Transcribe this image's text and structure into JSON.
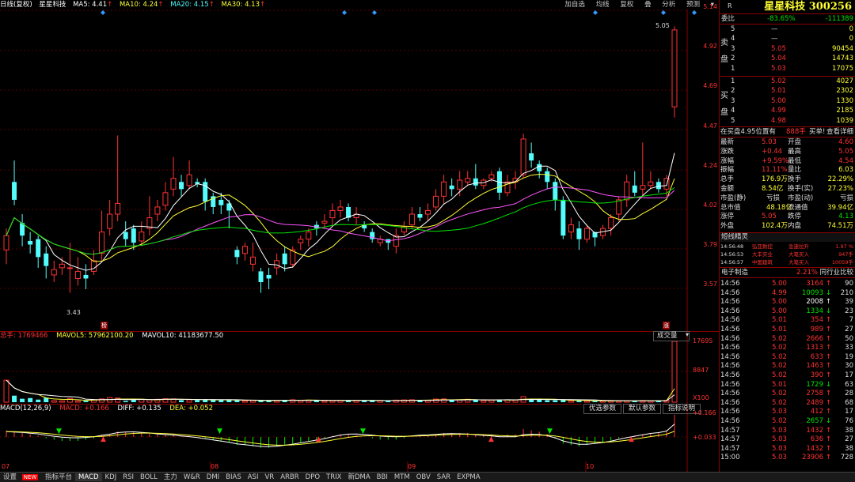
{
  "top": {
    "mode": "日线(复权)",
    "stock_name": "星星科技",
    "ma5": "MA5: 4.41",
    "ma10": "MA10: 4.24",
    "ma20": "MA20: 4.15",
    "ma30": "MA30: 4.13",
    "tools": [
      "加自选",
      "均线",
      "复权",
      "叠",
      "分析",
      "预测"
    ]
  },
  "price_axis": [
    "5.14",
    "4.92",
    "4.69",
    "4.47",
    "4.24",
    "4.02",
    "3.79",
    "3.57"
  ],
  "annotations": {
    "high": "5.05",
    "low": "3.43",
    "left_marker": "榜",
    "right_marker": "涨"
  },
  "volume": {
    "total": "总手: 1769466",
    "mavol5": "MAVOL5: 57962100.20",
    "mavol10": "MAVOL10: 41183677.50",
    "dropdown": "成交量",
    "axis": [
      "17695",
      "8847",
      "X100"
    ]
  },
  "macd": {
    "params": "MACD(12,26,9)",
    "macd": "MACD: +0.166",
    "diff": "DIFF: +0.135",
    "dea": "DEA: +0.052",
    "btn_pref": "优选参数",
    "btn_default": "默认参数",
    "btn_help": "指标说明",
    "axis": [
      "+0.166",
      "+0.033"
    ]
  },
  "months": [
    "07",
    "08",
    "09",
    "10"
  ],
  "bottom_tabs": {
    "settings": "设置",
    "new_badge": "NEW",
    "tabs": [
      "指标平台",
      "MACD",
      "KDJ",
      "RSI",
      "BOLL",
      "主力",
      "W&R",
      "DMI",
      "BIAS",
      "ASI",
      "VR",
      "ARBR",
      "DPO",
      "TRIX",
      "新DMA",
      "BBI",
      "MTM",
      "OBV",
      "SAR",
      "EXPMA"
    ]
  },
  "panel": {
    "r_label": "R",
    "title": "星星科技 300256",
    "weibi": {
      "label": "委比",
      "pct": "-83.65%",
      "diff": "-111389"
    },
    "sell_label": [
      "卖",
      "盘"
    ],
    "buy_label": [
      "买",
      "盘"
    ],
    "sells": [
      {
        "lvl": "5",
        "price": "—",
        "vol": "0"
      },
      {
        "lvl": "4",
        "price": "—",
        "vol": "0"
      },
      {
        "lvl": "3",
        "price": "5.05",
        "vol": "90454"
      },
      {
        "lvl": "2",
        "price": "5.04",
        "vol": "14743"
      },
      {
        "lvl": "1",
        "price": "5.03",
        "vol": "17075"
      }
    ],
    "buys": [
      {
        "lvl": "1",
        "price": "5.02",
        "vol": "4027"
      },
      {
        "lvl": "2",
        "price": "5.01",
        "vol": "2302"
      },
      {
        "lvl": "3",
        "price": "5.00",
        "vol": "1330"
      },
      {
        "lvl": "4",
        "price": "4.99",
        "vol": "2185"
      },
      {
        "lvl": "5",
        "price": "4.98",
        "vol": "1039"
      }
    ],
    "order_bar": {
      "text": "在买盘4.95位置有",
      "vol": "888手",
      "buy": "买单!",
      "detail": "查看详细"
    },
    "quotes": [
      {
        "l1": "最新",
        "v1": "5.03",
        "l2": "开盘",
        "v2": "4.60"
      },
      {
        "l1": "涨跌",
        "v1": "+0.44",
        "l2": "最高",
        "v2": "5.05"
      },
      {
        "l1": "涨幅",
        "v1": "+9.59%",
        "l2": "最低",
        "v2": "4.54"
      },
      {
        "l1": "振幅",
        "v1": "11.11%",
        "l2": "量比",
        "v2": "6.03"
      },
      {
        "l1": "总手",
        "v1": "176.9万",
        "l2": "换手",
        "v2": "22.29%"
      },
      {
        "l1": "金额",
        "v1": "8.54亿",
        "l2": "换手(实)",
        "v2": "27.23%"
      },
      {
        "l1": "市盈(静)",
        "v1": "亏损",
        "l2": "市盈(动)",
        "v2": "亏损"
      },
      {
        "l1": "总市值",
        "v1": "48.18亿",
        "l2": "流通值",
        "v2": "39.94亿"
      },
      {
        "l1": "涨停",
        "v1": "5.05",
        "l2": "跌停",
        "v2": "4.13"
      },
      {
        "l1": "外盘",
        "v1": "102.4万",
        "l2": "内盘",
        "v2": "74.51万"
      }
    ],
    "elves_title": "短线精灵",
    "elves": [
      {
        "t": "14:56:48",
        "n": "弘亚数控",
        "e": "急速拉升",
        "v": "1.97 %"
      },
      {
        "t": "14:56:53",
        "n": "大丰实业",
        "e": "大笔买入",
        "v": "947手"
      },
      {
        "t": "14:56:57",
        "n": "中国建筑",
        "e": "大笔买入",
        "v": "10059手"
      }
    ],
    "sector": {
      "name": "电子制造",
      "pct": "2.21%",
      "compare": "同行业比较"
    },
    "trades": [
      {
        "t": "14:56",
        "p": "5.00",
        "v": "3164",
        "d": "up",
        "n": "90"
      },
      {
        "t": "14:56",
        "p": "4.99",
        "v": "10093",
        "d": "down",
        "n": "210"
      },
      {
        "t": "14:56",
        "p": "5.00",
        "v": "2008",
        "d": "upw",
        "n": "39"
      },
      {
        "t": "14:56",
        "p": "5.00",
        "v": "1334",
        "d": "down",
        "n": "23"
      },
      {
        "t": "14:56",
        "p": "5.01",
        "v": "354",
        "d": "up",
        "n": "7"
      },
      {
        "t": "14:56",
        "p": "5.01",
        "v": "989",
        "d": "up",
        "n": "27"
      },
      {
        "t": "14:56",
        "p": "5.02",
        "v": "2666",
        "d": "up",
        "n": "50"
      },
      {
        "t": "14:56",
        "p": "5.02",
        "v": "1313",
        "d": "up",
        "n": "33"
      },
      {
        "t": "14:56",
        "p": "5.02",
        "v": "633",
        "d": "up",
        "n": "19"
      },
      {
        "t": "14:56",
        "p": "5.02",
        "v": "1463",
        "d": "up",
        "n": "30"
      },
      {
        "t": "14:56",
        "p": "5.02",
        "v": "390",
        "d": "up",
        "n": "17"
      },
      {
        "t": "14:56",
        "p": "5.01",
        "v": "1729",
        "d": "down",
        "n": "63"
      },
      {
        "t": "14:56",
        "p": "5.02",
        "v": "2758",
        "d": "up",
        "n": "28"
      },
      {
        "t": "14:56",
        "p": "5.02",
        "v": "2489",
        "d": "up",
        "n": "68"
      },
      {
        "t": "14:56",
        "p": "5.03",
        "v": "412",
        "d": "up",
        "n": "17"
      },
      {
        "t": "14:56",
        "p": "5.02",
        "v": "2657",
        "d": "down",
        "n": "76"
      },
      {
        "t": "14:57",
        "p": "5.03",
        "v": "1432",
        "d": "up",
        "n": "38"
      },
      {
        "t": "14:57",
        "p": "5.03",
        "v": "636",
        "d": "up",
        "n": "27"
      },
      {
        "t": "14:57",
        "p": "5.03",
        "v": "1432",
        "d": "up",
        "n": "38"
      },
      {
        "t": "15:00",
        "p": "5.03",
        "v": "23906",
        "d": "up",
        "n": "728"
      }
    ]
  },
  "colors": {
    "up": "#ff3232",
    "down": "#54fcfc",
    "ma5": "#ffffff",
    "ma10": "#ffff33",
    "ma20": "#ff55ff",
    "ma30": "#00e600"
  },
  "chart_data": {
    "type": "candlestick",
    "candles": [
      [
        3.8,
        3.88,
        3.72,
        3.92
      ],
      [
        4.18,
        4.08,
        4.05,
        4.3
      ],
      [
        3.95,
        3.88,
        3.82,
        4.0
      ],
      [
        3.85,
        3.83,
        3.78,
        3.9
      ],
      [
        3.86,
        3.76,
        3.7,
        3.88
      ],
      [
        3.78,
        3.71,
        3.64,
        3.82
      ],
      [
        3.66,
        3.69,
        3.62,
        3.74
      ],
      [
        3.7,
        3.72,
        3.66,
        3.76
      ],
      [
        3.7,
        3.7,
        3.56,
        3.84
      ],
      [
        3.64,
        3.68,
        3.6,
        3.76
      ],
      [
        3.66,
        3.64,
        3.58,
        3.72
      ],
      [
        3.68,
        3.74,
        3.66,
        3.8
      ],
      [
        3.78,
        3.9,
        3.74,
        4.02
      ],
      [
        3.92,
        4.0,
        3.88,
        4.08
      ],
      [
        4.0,
        4.06,
        3.96,
        4.44
      ],
      [
        3.9,
        3.86,
        3.82,
        3.96
      ],
      [
        3.92,
        3.84,
        3.8,
        3.94
      ],
      [
        3.85,
        3.9,
        3.82,
        3.96
      ],
      [
        3.92,
        3.98,
        3.88,
        4.1
      ],
      [
        4.0,
        4.04,
        3.96,
        4.08
      ],
      [
        4.05,
        4.12,
        4.02,
        4.18
      ],
      [
        4.14,
        4.2,
        4.1,
        4.32
      ],
      [
        4.18,
        4.14,
        4.1,
        4.22
      ],
      [
        4.16,
        4.22,
        4.14,
        4.3
      ],
      [
        4.18,
        4.17,
        4.15,
        4.2
      ],
      [
        4.18,
        4.07,
        4.02,
        4.2
      ],
      [
        4.1,
        4.04,
        4.0,
        4.12
      ],
      [
        4.08,
        4.05,
        4.0,
        4.12
      ],
      [
        4.06,
        4.02,
        3.92,
        4.08
      ],
      [
        3.8,
        3.76,
        3.72,
        3.82
      ],
      [
        3.78,
        3.82,
        3.74,
        3.84
      ],
      [
        3.72,
        3.76,
        3.68,
        3.84
      ],
      [
        3.68,
        3.62,
        3.56,
        3.7
      ],
      [
        3.66,
        3.64,
        3.58,
        3.7
      ],
      [
        3.7,
        3.74,
        3.66,
        3.78
      ],
      [
        3.78,
        3.72,
        3.68,
        3.82
      ],
      [
        3.72,
        3.8,
        3.7,
        3.82
      ],
      [
        3.84,
        3.86,
        3.8,
        3.88
      ],
      [
        3.86,
        3.9,
        3.82,
        3.92
      ],
      [
        3.94,
        3.92,
        3.88,
        3.96
      ],
      [
        3.95,
        3.96,
        3.92,
        4.0
      ],
      [
        3.98,
        4.02,
        3.94,
        4.06
      ],
      [
        4.02,
        4.04,
        3.98,
        4.08
      ],
      [
        4.04,
        3.98,
        3.96,
        4.06
      ],
      [
        3.98,
        4.0,
        3.94,
        4.04
      ],
      [
        3.94,
        3.92,
        3.9,
        3.96
      ],
      [
        3.9,
        3.86,
        3.84,
        3.92
      ],
      [
        3.84,
        3.86,
        3.82,
        3.88
      ],
      [
        3.86,
        3.84,
        3.8,
        3.86
      ],
      [
        3.82,
        3.88,
        3.78,
        3.92
      ],
      [
        3.9,
        3.93,
        3.88,
        3.96
      ],
      [
        3.94,
        4.0,
        3.92,
        4.04
      ],
      [
        4.0,
        3.98,
        3.96,
        4.04
      ],
      [
        4.0,
        4.02,
        3.96,
        4.06
      ],
      [
        4.04,
        4.1,
        4.02,
        4.14
      ],
      [
        4.1,
        4.18,
        4.06,
        4.22
      ],
      [
        4.16,
        4.14,
        4.1,
        4.2
      ],
      [
        4.14,
        4.19,
        4.1,
        4.24
      ],
      [
        4.18,
        4.2,
        4.16,
        4.24
      ],
      [
        4.2,
        4.16,
        4.14,
        4.28
      ],
      [
        4.16,
        4.19,
        4.14,
        4.2
      ],
      [
        4.2,
        4.22,
        4.18,
        4.24
      ],
      [
        4.24,
        4.12,
        4.08,
        4.26
      ],
      [
        4.12,
        4.18,
        4.1,
        4.22
      ],
      [
        4.18,
        4.2,
        4.14,
        4.24
      ],
      [
        4.22,
        4.42,
        4.2,
        4.45
      ],
      [
        4.34,
        4.3,
        4.26,
        4.4
      ],
      [
        4.28,
        4.24,
        4.2,
        4.3
      ],
      [
        4.24,
        4.18,
        4.14,
        4.26
      ],
      [
        4.18,
        4.08,
        4.02,
        4.2
      ],
      [
        4.08,
        3.88,
        3.86,
        4.1
      ],
      [
        3.9,
        3.94,
        3.86,
        3.98
      ],
      [
        3.92,
        3.86,
        3.8,
        3.96
      ],
      [
        3.86,
        3.92,
        3.84,
        3.94
      ],
      [
        3.9,
        3.87,
        3.82,
        3.9
      ],
      [
        3.88,
        3.92,
        3.86,
        3.94
      ],
      [
        3.92,
        3.98,
        3.88,
        4.0
      ],
      [
        4.0,
        4.08,
        3.96,
        4.1
      ],
      [
        4.08,
        4.18,
        4.04,
        4.22
      ],
      [
        4.16,
        4.12,
        4.1,
        4.24
      ],
      [
        4.14,
        4.16,
        4.1,
        4.4
      ],
      [
        4.16,
        4.18,
        4.14,
        4.24
      ],
      [
        4.18,
        4.14,
        4.12,
        4.2
      ],
      [
        4.14,
        4.2,
        4.1,
        4.22
      ],
      [
        4.6,
        5.03,
        4.54,
        5.05
      ]
    ],
    "volume_x100": [
      640,
      190,
      100,
      120,
      75,
      130,
      45,
      40,
      110,
      35,
      40,
      75,
      95,
      135,
      120,
      35,
      70,
      85,
      75,
      85,
      100,
      95,
      60,
      70,
      65,
      75,
      65,
      65,
      60,
      55,
      40,
      50,
      40,
      45,
      55,
      65,
      70,
      55,
      60,
      45,
      40,
      50,
      55,
      45,
      55,
      45,
      55,
      45,
      35,
      60,
      65,
      70,
      55,
      50,
      90,
      95,
      60,
      70,
      85,
      60,
      50,
      60,
      80,
      70,
      60,
      160,
      95,
      75,
      55,
      55,
      60,
      45,
      40,
      40,
      30,
      35,
      40,
      40,
      45,
      40,
      50,
      45,
      40,
      55,
      1769
    ],
    "macd_hist": [
      0.05,
      0.04,
      0.03,
      0.02,
      0.01,
      -0.01,
      -0.02,
      -0.03,
      -0.03,
      -0.03,
      -0.02,
      -0.01,
      0.01,
      0.02,
      0.04,
      0.04,
      0.04,
      0.03,
      0.03,
      0.02,
      0.02,
      0.02,
      0.01,
      0.01,
      0.0,
      -0.01,
      -0.02,
      -0.03,
      -0.04,
      -0.06,
      -0.06,
      -0.07,
      -0.08,
      -0.08,
      -0.07,
      -0.06,
      -0.05,
      -0.04,
      -0.03,
      -0.02,
      -0.01,
      0.01,
      0.02,
      0.02,
      0.01,
      0.0,
      -0.01,
      -0.02,
      -0.02,
      -0.02,
      -0.01,
      0.0,
      0.01,
      0.01,
      0.02,
      0.03,
      0.03,
      0.03,
      0.03,
      0.02,
      0.02,
      0.02,
      0.01,
      0.02,
      0.02,
      0.06,
      0.05,
      0.04,
      0.02,
      -0.01,
      -0.05,
      -0.06,
      -0.07,
      -0.06,
      -0.05,
      -0.04,
      -0.03,
      -0.01,
      0.0,
      0.01,
      0.02,
      0.03,
      0.03,
      0.05,
      0.166
    ],
    "ylim": [
      3.43,
      5.14
    ]
  }
}
